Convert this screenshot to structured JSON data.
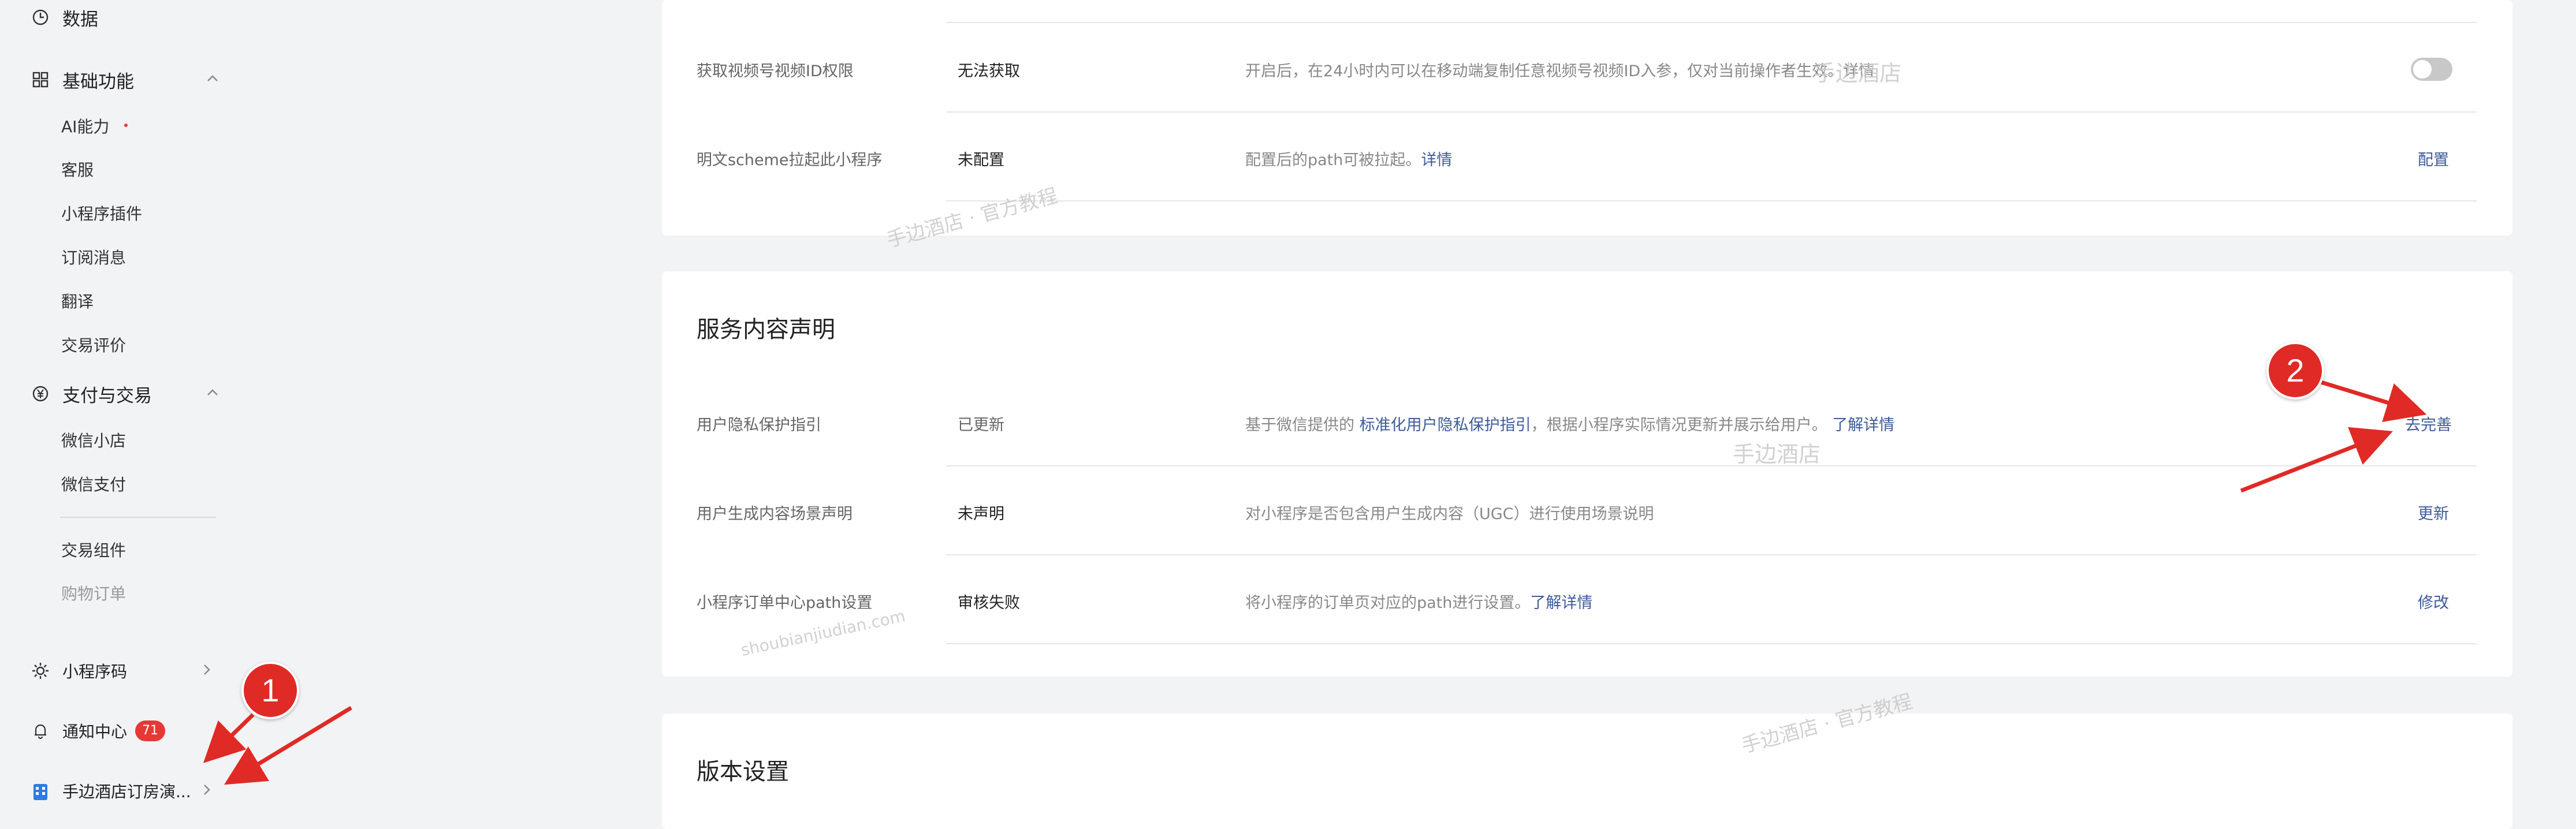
{
  "sidebar": {
    "data_item": {
      "label": "数据",
      "icon": "clock-icon"
    },
    "basic": {
      "label": "基础功能",
      "icon": "grid-icon",
      "items": [
        {
          "label": "AI能力",
          "dot": true
        },
        {
          "label": "客服"
        },
        {
          "label": "小程序插件"
        },
        {
          "label": "订阅消息"
        },
        {
          "label": "翻译"
        },
        {
          "label": "交易评价"
        }
      ]
    },
    "payment": {
      "label": "支付与交易",
      "icon": "yen-icon",
      "items": [
        {
          "label": "微信小店"
        },
        {
          "label": "微信支付"
        },
        {
          "label": "交易组件"
        },
        {
          "label": "购物订单"
        }
      ]
    },
    "qrcode": {
      "label": "小程序码",
      "icon": "sun-icon"
    },
    "notify": {
      "label": "通知中心",
      "count": "71",
      "icon": "bell-icon"
    },
    "account": {
      "label": "手边酒店订房演...",
      "icon": "building-icon"
    }
  },
  "top_card": {
    "rows": [
      {
        "label": "获取视频号视频ID权限",
        "status": "无法获取",
        "desc": "开启后，在24小时内可以在移动端复制任意视频号视频ID入参，仅对当前操作者生效。详情",
        "toggle": false
      },
      {
        "label": "明文scheme拉起此小程序",
        "status": "未配置",
        "desc": "配置后的path可被拉起。",
        "desc_link": "详情",
        "action": "配置"
      }
    ]
  },
  "service_card": {
    "title": "服务内容声明",
    "rows": [
      {
        "label": "用户隐私保护指引",
        "status": "已更新",
        "desc_pre": "基于微信提供的",
        "desc_link1": "标准化用户隐私保护指引",
        "desc_mid": "，根据小程序实际情况更新并展示给用户。",
        "desc_link2": "了解详情",
        "action": "去完善"
      },
      {
        "label": "用户生成内容场景声明",
        "status": "未声明",
        "desc": "对小程序是否包含用户生成内容（UGC）进行使用场景说明",
        "action": "更新"
      },
      {
        "label": "小程序订单中心path设置",
        "status": "审核失败",
        "desc": "将小程序的订单页对应的path进行设置。",
        "desc_link": "了解详情",
        "action": "修改"
      }
    ]
  },
  "version_card": {
    "title": "版本设置"
  },
  "watermarks": {
    "w1": "手边酒店 · 官方教程",
    "w2": "手边酒店",
    "w3": "shoubianjiudian.com",
    "w4": "手边酒店 · 官方教程",
    "w5": "手边酒店"
  },
  "markers": {
    "m1": "1",
    "m2": "2"
  },
  "colors": {
    "accent_link": "#3e5b9a",
    "badge_red": "#e53935",
    "marker_red": "#e02a25"
  }
}
